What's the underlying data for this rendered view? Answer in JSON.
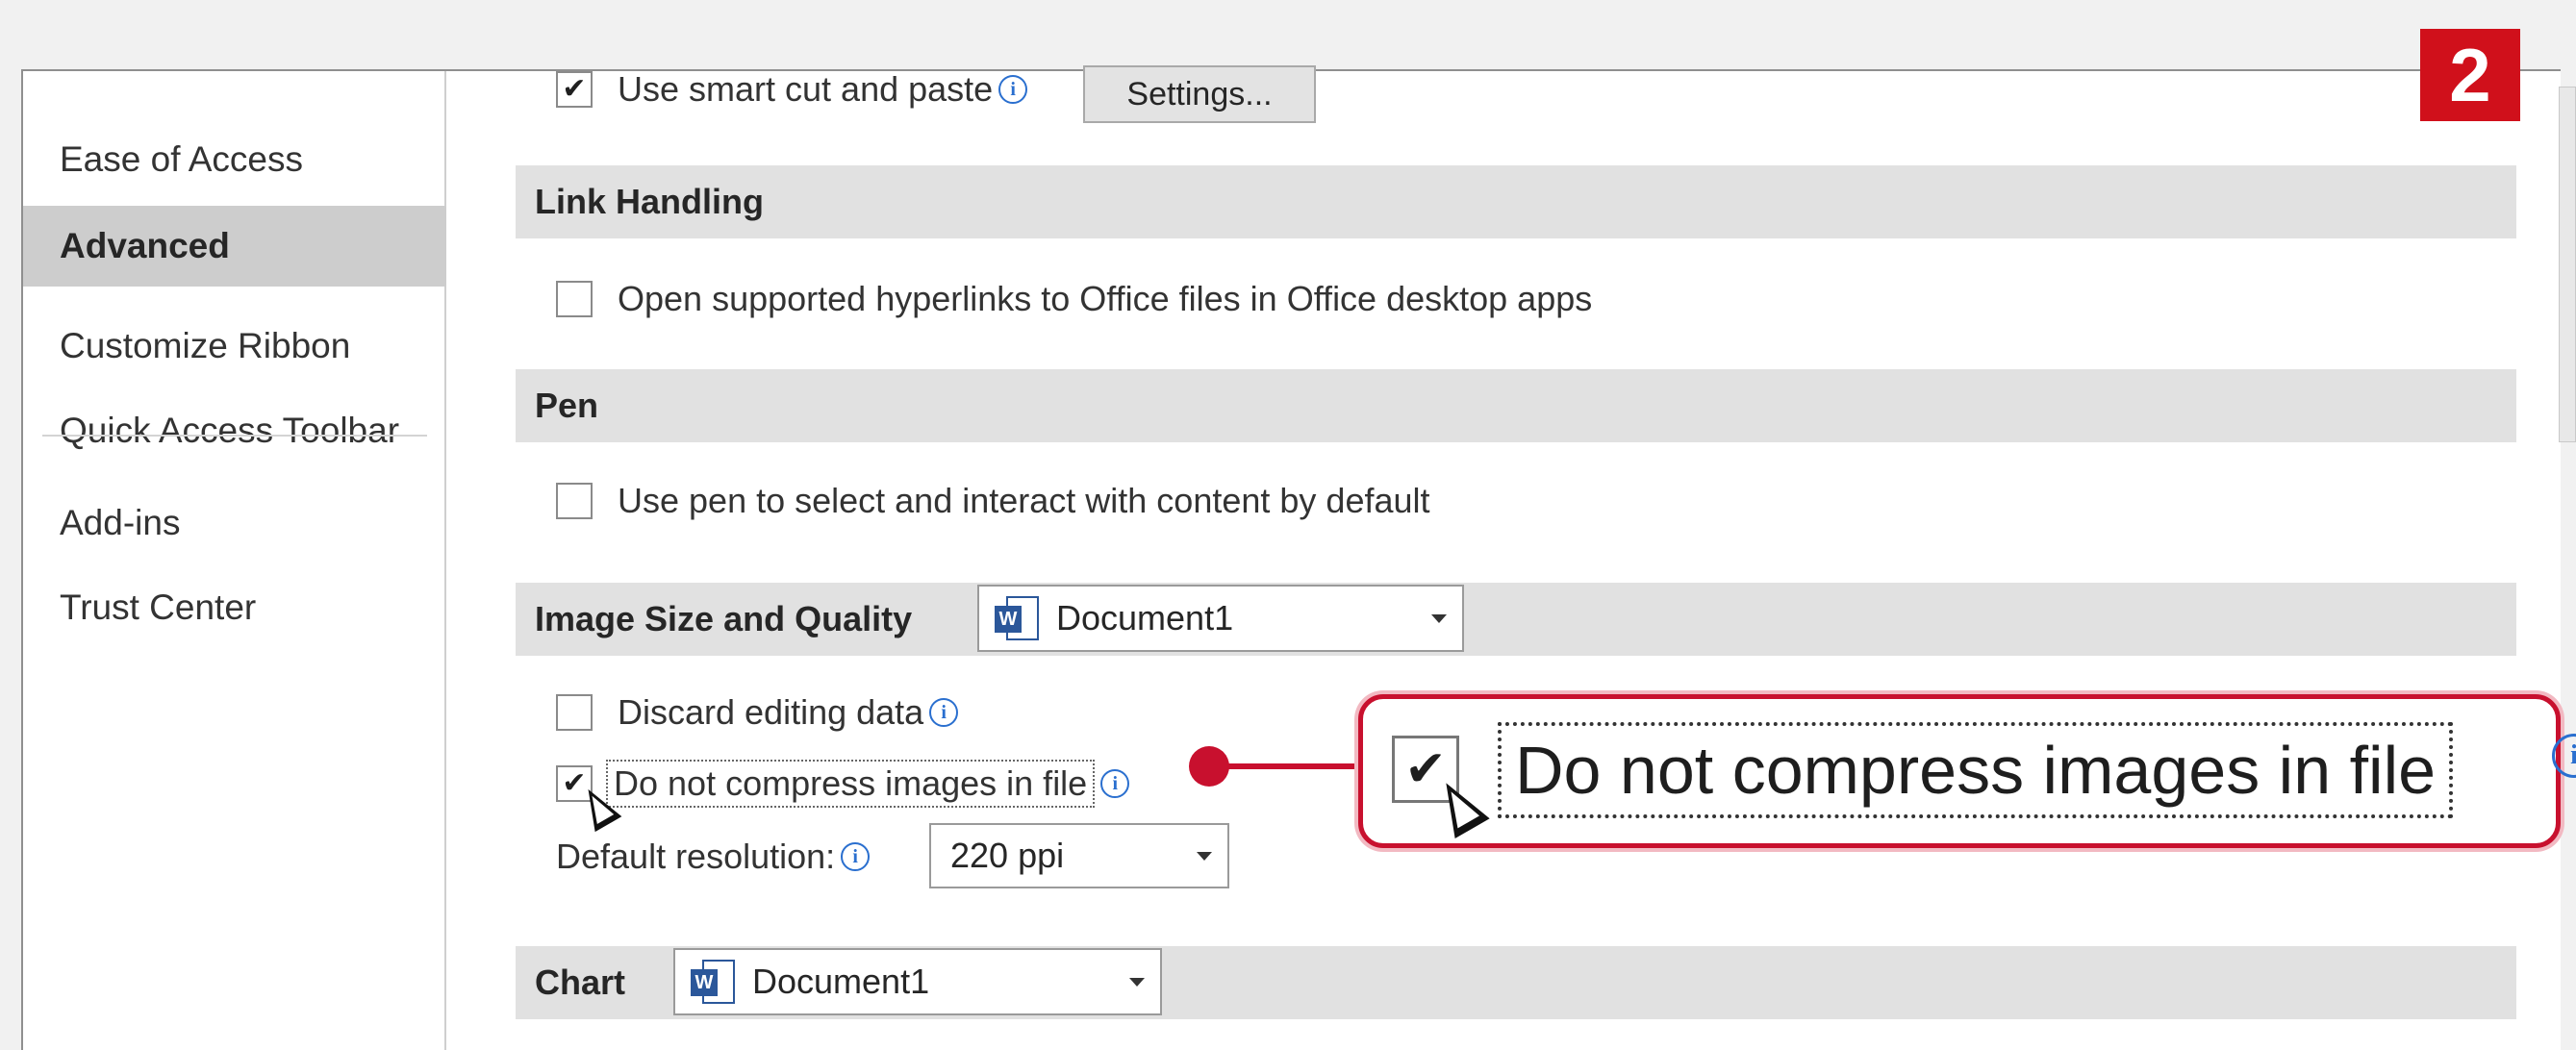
{
  "sidebar": {
    "items": [
      {
        "label": "Ease of Access",
        "active": false
      },
      {
        "label": "Advanced",
        "active": true
      },
      {
        "label": "Customize Ribbon",
        "active": false
      },
      {
        "label": "Quick Access Toolbar",
        "active": false
      },
      {
        "label": "Add-ins",
        "active": false
      },
      {
        "label": "Trust Center",
        "active": false
      }
    ]
  },
  "main": {
    "smart_cut": {
      "label": "Use smart cut and paste",
      "checked": true,
      "button_label": "Settings..."
    },
    "link_handling": {
      "title": "Link Handling",
      "option_label": "Open supported hyperlinks to Office files in Office desktop apps",
      "checked": false
    },
    "pen": {
      "title": "Pen",
      "option_label": "Use pen to select and interact with content by default",
      "checked": false
    },
    "image_size": {
      "title": "Image Size and Quality",
      "document": "Document1",
      "discard_label": "Discard editing data",
      "discard_checked": false,
      "no_compress_label": "Do not compress images in file",
      "no_compress_checked": true,
      "resolution_label": "Default resolution:",
      "resolution_value": "220 ppi"
    },
    "chart": {
      "title": "Chart",
      "document": "Document1"
    }
  },
  "callout": {
    "label": "Do not compress images in file",
    "checked": true,
    "color": "#c8102e"
  },
  "step_badge": {
    "label": "2",
    "color": "#d0101b"
  },
  "icons": {
    "check": "✔",
    "info": "i",
    "word_letter": "W"
  }
}
